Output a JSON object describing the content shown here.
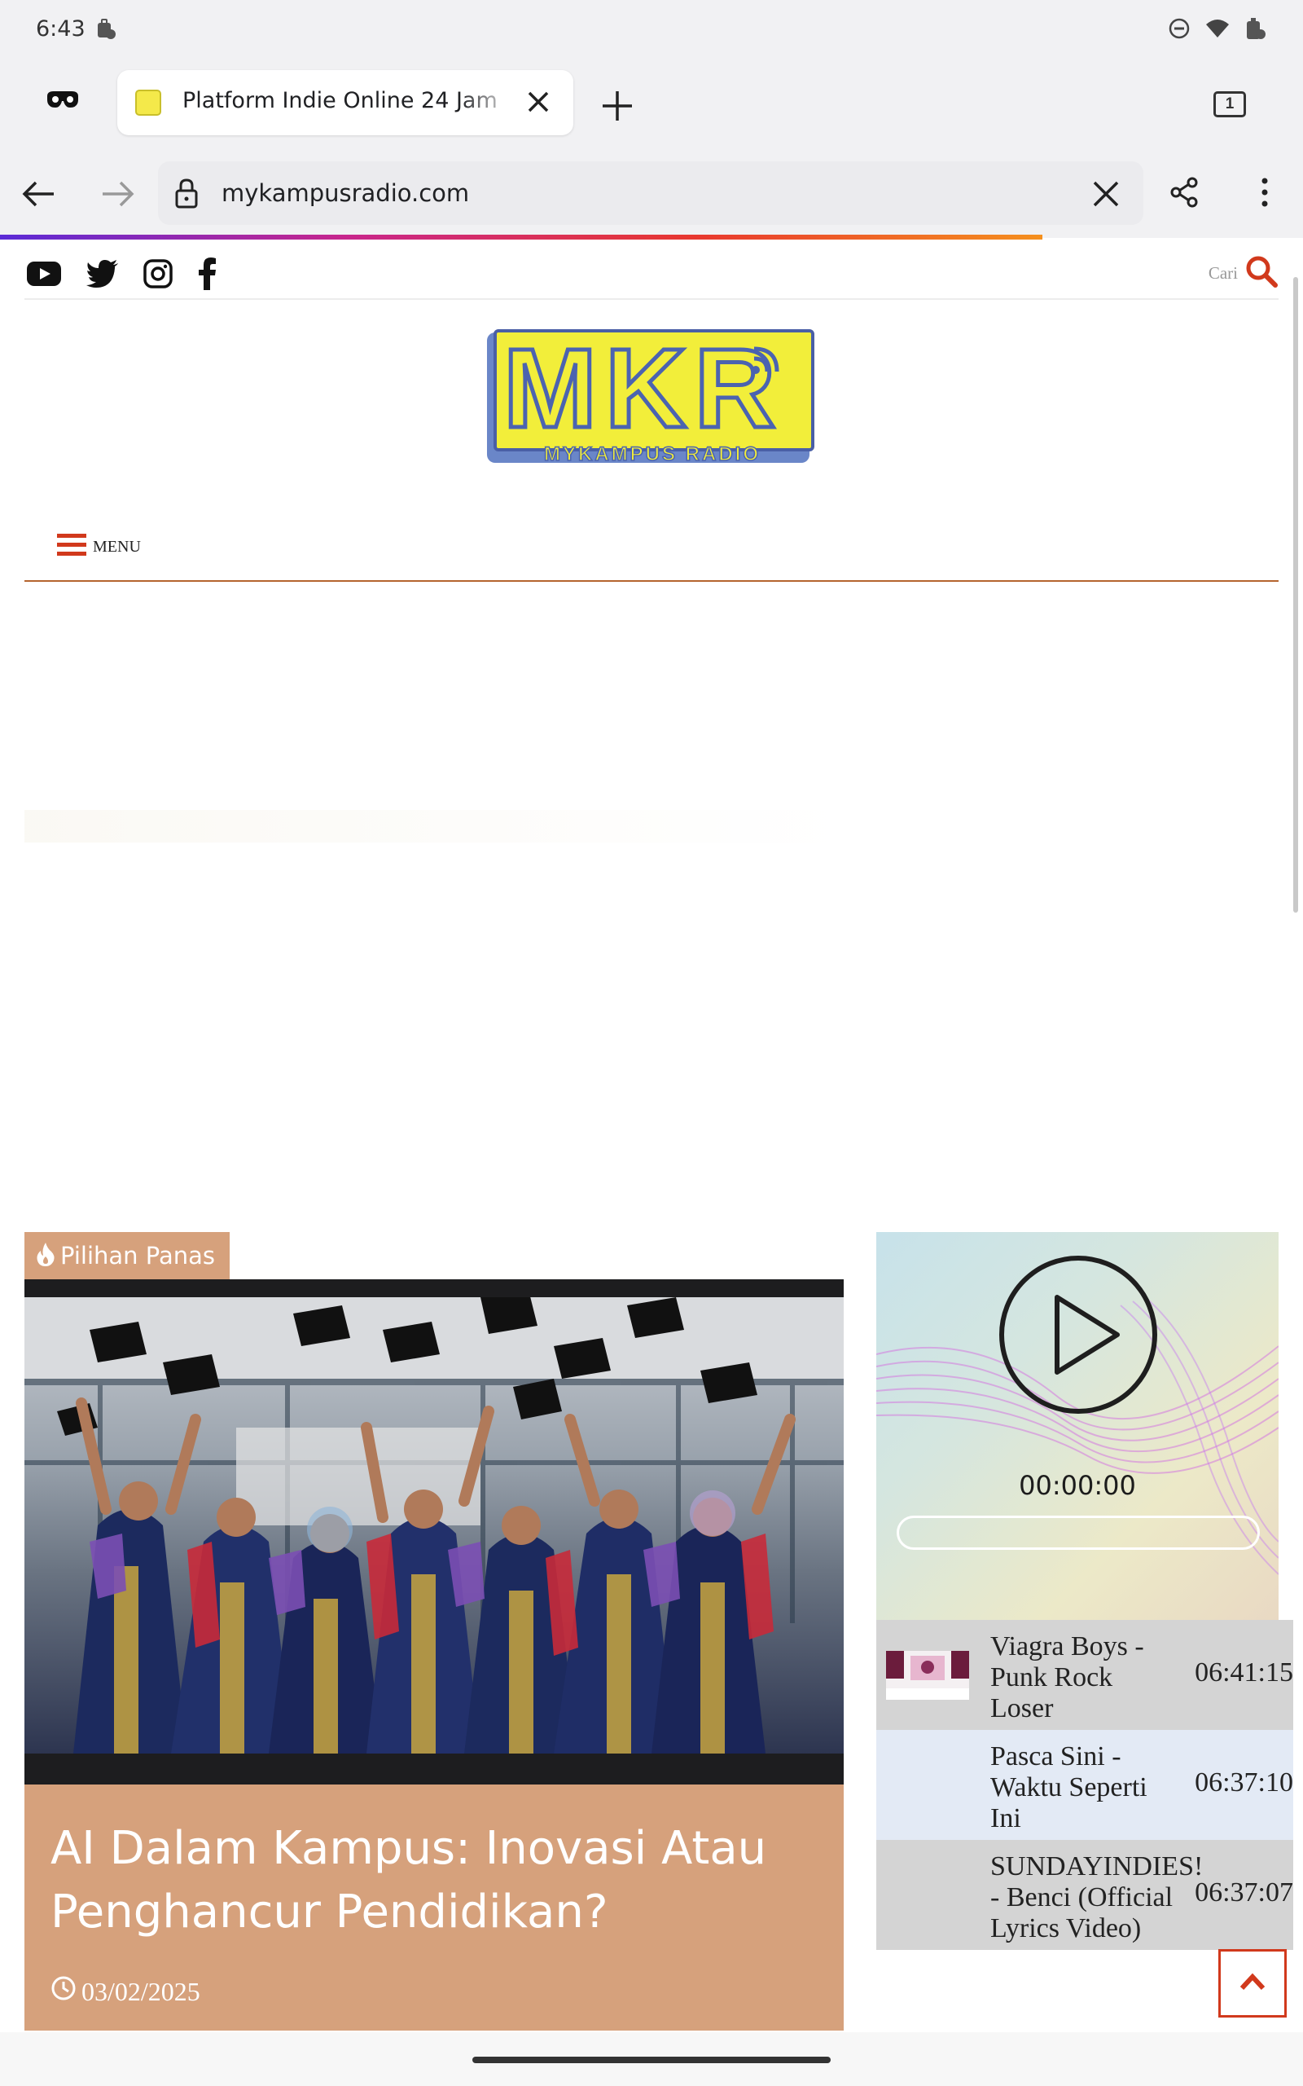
{
  "status_bar": {
    "time": "6:43"
  },
  "browser": {
    "tab_title": "Platform Indie Online 24 Jam",
    "tab_count": "1",
    "url": "mykampusradio.com"
  },
  "site": {
    "search_label": "Cari",
    "logo_text": "MKR",
    "logo_subtitle": "MYKAMPUS RADIO",
    "menu_label": "MENU",
    "social_icons": [
      "youtube-icon",
      "twitter-icon",
      "instagram-icon",
      "facebook-icon"
    ],
    "accent_color": "#d1391c",
    "card_color": "#d6a17c"
  },
  "featured": {
    "badge": "Pilihan Panas",
    "title": "AI Dalam Kampus: Inovasi Atau Penghancur Pendidikan?",
    "date": "03/02/2025"
  },
  "player": {
    "time": "00:00:00",
    "playlist": [
      {
        "title": "Viagra Boys - Punk Rock Loser",
        "time": "06:41:15"
      },
      {
        "title": "Pasca Sini - Waktu Seperti Ini",
        "time": "06:37:10"
      },
      {
        "title": "SUNDAYINDIES! - Benci (Official Lyrics Video)",
        "time": "06:37:07"
      }
    ]
  }
}
